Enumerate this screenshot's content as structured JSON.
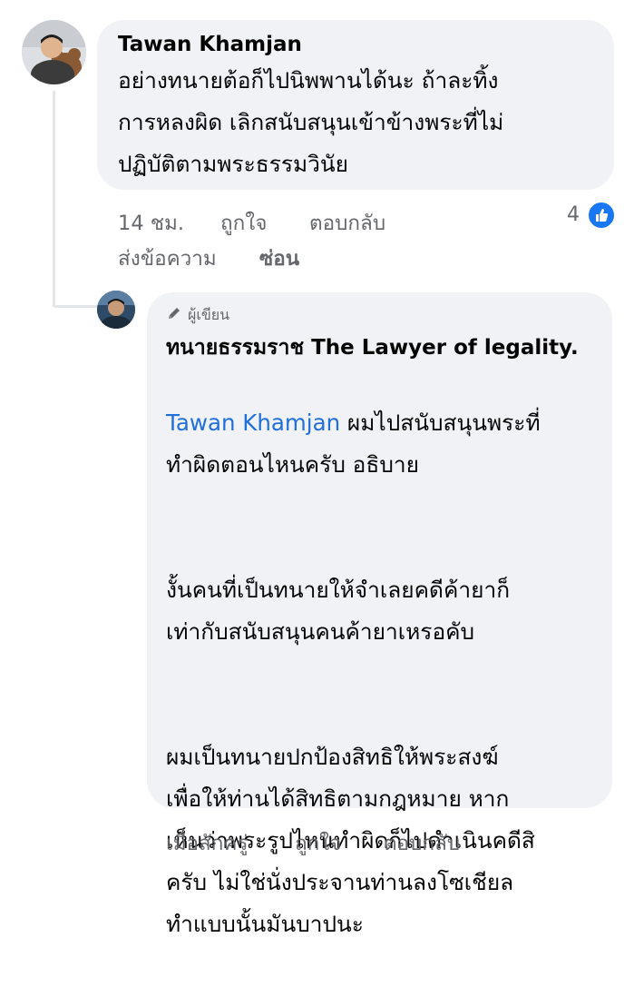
{
  "comment": {
    "author": "Tawan Khamjan",
    "text": "อย่างทนายต้อก็ไปนิพพานได้นะ ถ้าละทิ้ง\nการหลงผิด เลิกสนับสนุนเข้าข้างพระที่ไม่\nปฏิบัติตามพระธรรมวินัย",
    "time": "14 ชม.",
    "like_action": "ถูกใจ",
    "reply_action": "ตอบกลับ",
    "message_action": "ส่งข้อความ",
    "hide_action": "ซ่อน",
    "like_count": "4"
  },
  "reply": {
    "badge": "ผู้เขียน",
    "author": "ทนายธรรมราช The Lawyer of  legality.",
    "mention": "Tawan Khamjan",
    "text_after_mention": " ผมไปสนับสนุนพระที่\nทำผิดตอนไหนครับ อธิบาย",
    "paragraph2": "งั้นคนที่เป็นทนายให้จำเลยคดีค้ายาก็\nเท่ากับสนับสนุนคนค้ายาเหรอคับ",
    "paragraph3": "ผมเป็นทนายปกป้องสิทธิให้พระสงฆ์\nเพื่อให้ท่านได้สิทธิตามกฎหมาย หาก\nเห็นว่าพระรูปไหนทำผิดก็ไปดำเนินคดีสิ\nครับ ไม่ใช่นั่งประจานท่านลงโซเชียล\nทำแบบนั้นมันบาปนะ",
    "time": "เมื่อสักครู่",
    "like_action": "ถูกใจ",
    "reply_action": "ตอบกลับ"
  },
  "colors": {
    "bubble": "#f0f2f5",
    "meta": "#65676b",
    "mention": "#216fdb",
    "like_blue": "#1877f2"
  }
}
